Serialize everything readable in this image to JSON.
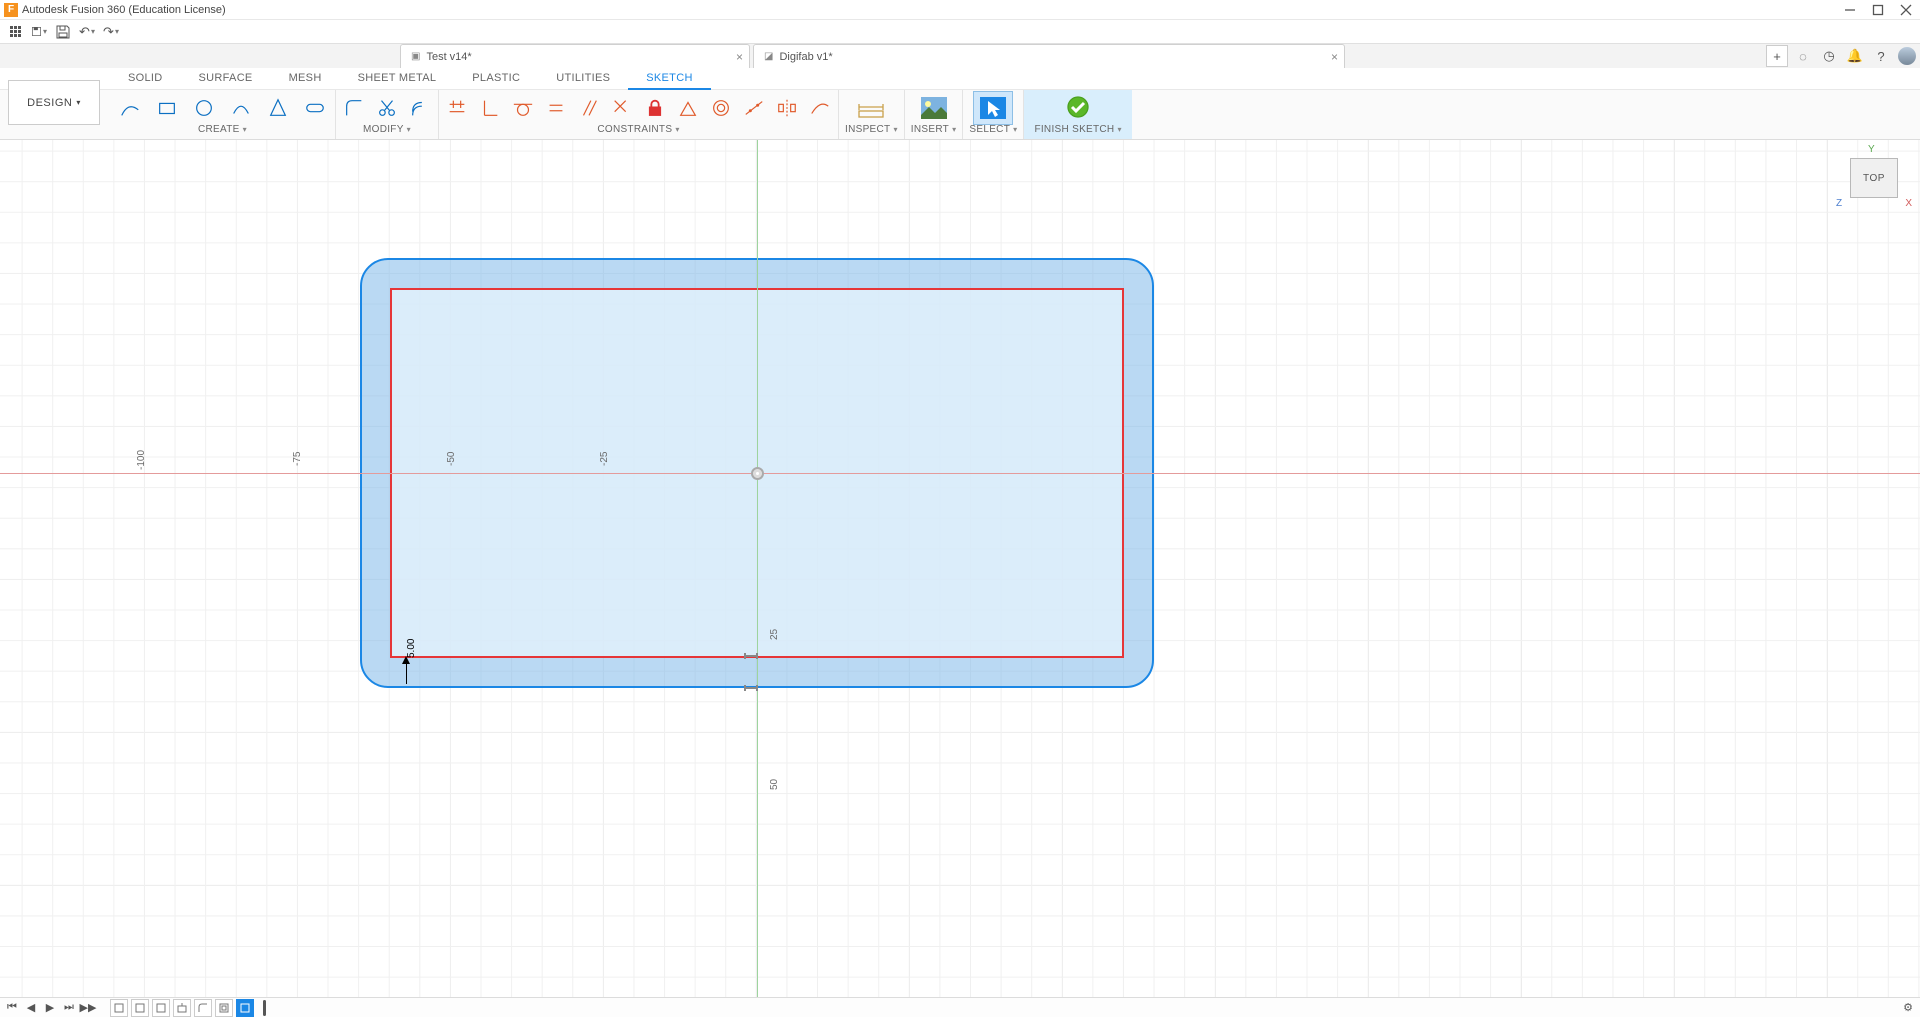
{
  "title_bar": {
    "app_title": "Autodesk Fusion 360 (Education License)"
  },
  "file_tabs": [
    {
      "label": "Test v14*",
      "type": "assembly",
      "close": "×"
    },
    {
      "label": "Digifab v1*",
      "type": "design",
      "close": "×"
    }
  ],
  "workspace": {
    "selector_label": "DESIGN",
    "tabs": [
      "SOLID",
      "SURFACE",
      "MESH",
      "SHEET METAL",
      "PLASTIC",
      "UTILITIES",
      "SKETCH"
    ],
    "active_tab": "SKETCH"
  },
  "ribbon": {
    "panels": {
      "create": "CREATE",
      "modify": "MODIFY",
      "constraints": "CONSTRAINTS",
      "inspect": "INSPECT",
      "insert": "INSERT",
      "select": "SELECT",
      "finish": "FINISH SKETCH"
    }
  },
  "view_cube": {
    "face": "TOP",
    "axes": {
      "x": "X",
      "y": "Y",
      "z": "Z"
    }
  },
  "canvas": {
    "ruler_ticks": [
      "-100",
      "-75",
      "-50",
      "-25",
      "25",
      "50"
    ],
    "dimension_value": "5.00"
  },
  "timeline": {
    "play_controls": [
      "⏮",
      "◀",
      "▶",
      "⏭",
      "▶▶"
    ]
  }
}
